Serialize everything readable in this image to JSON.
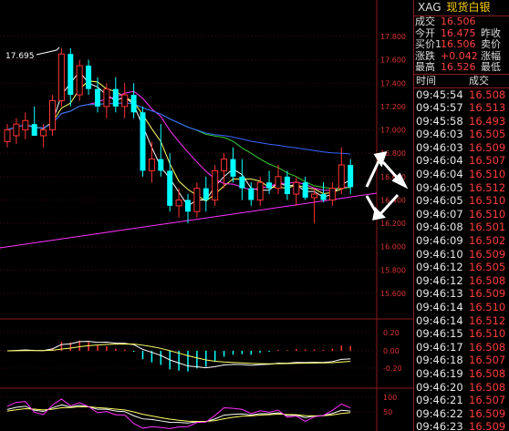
{
  "header": {
    "symbol": "XAG",
    "name": "现货白银"
  },
  "quote": [
    {
      "label": "成交",
      "value": "16.506",
      "label2": ""
    },
    {
      "label": "今开",
      "value": "16.475",
      "label2": "昨收"
    },
    {
      "label": "买价1",
      "value": "16.506",
      "label2": "卖价"
    },
    {
      "label": "涨跌",
      "value": "+0.042",
      "label2": "涨幅"
    },
    {
      "label": "最高",
      "value": "16.526",
      "label2": "最低"
    }
  ],
  "ticks_header": {
    "time": "时间",
    "price": "成交"
  },
  "ticks": [
    {
      "time": "09:45:54",
      "price": "16.508"
    },
    {
      "time": "09:45:57",
      "price": "16.513"
    },
    {
      "time": "09:45:58",
      "price": "16.493"
    },
    {
      "time": "09:46:03",
      "price": "16.505"
    },
    {
      "time": "09:46:03",
      "price": "16.509"
    },
    {
      "time": "09:46:04",
      "price": "16.507"
    },
    {
      "time": "09:46:04",
      "price": "16.510"
    },
    {
      "time": "09:46:05",
      "price": "16.512"
    },
    {
      "time": "09:46:05",
      "price": "16.510"
    },
    {
      "time": "09:46:07",
      "price": "16.510"
    },
    {
      "time": "09:46:08",
      "price": "16.501"
    },
    {
      "time": "09:46:09",
      "price": "16.502"
    },
    {
      "time": "09:46:10",
      "price": "16.509"
    },
    {
      "time": "09:46:12",
      "price": "16.505"
    },
    {
      "time": "09:46:12",
      "price": "16.508"
    },
    {
      "time": "09:46:13",
      "price": "16.509"
    },
    {
      "time": "09:46:14",
      "price": "16.510"
    },
    {
      "time": "09:46:14",
      "price": "16.512"
    },
    {
      "time": "09:46:15",
      "price": "16.510"
    },
    {
      "time": "09:46:17",
      "price": "16.508"
    },
    {
      "time": "09:46:18",
      "price": "16.507"
    },
    {
      "time": "09:46:19",
      "price": "16.508"
    },
    {
      "time": "09:46:20",
      "price": "16.508"
    },
    {
      "time": "09:46:21",
      "price": "16.507"
    },
    {
      "time": "09:46:22",
      "price": "16.509"
    },
    {
      "time": "09:46:23",
      "price": "16.509"
    }
  ],
  "main_chart": {
    "annotation": "17.695",
    "y_ticks": [
      "17.800",
      "17.600",
      "17.400",
      "17.200",
      "17.000",
      "16.800",
      "16.600",
      "16.400",
      "16.200",
      "16.000",
      "15.800",
      "15.600"
    ],
    "candles": [
      {
        "o": 16.9,
        "h": 17.05,
        "l": 16.85,
        "c": 17.0
      },
      {
        "o": 16.95,
        "h": 17.1,
        "l": 16.88,
        "c": 17.05
      },
      {
        "o": 17.0,
        "h": 17.15,
        "l": 16.92,
        "c": 17.08
      },
      {
        "o": 17.05,
        "h": 17.2,
        "l": 16.98,
        "c": 16.95
      },
      {
        "o": 16.95,
        "h": 17.05,
        "l": 16.85,
        "c": 17.0
      },
      {
        "o": 17.0,
        "h": 17.3,
        "l": 16.95,
        "c": 17.25
      },
      {
        "o": 17.25,
        "h": 17.7,
        "l": 17.2,
        "c": 17.65
      },
      {
        "o": 17.65,
        "h": 17.7,
        "l": 17.2,
        "c": 17.3
      },
      {
        "o": 17.3,
        "h": 17.6,
        "l": 17.25,
        "c": 17.55
      },
      {
        "o": 17.55,
        "h": 17.6,
        "l": 17.3,
        "c": 17.35
      },
      {
        "o": 17.35,
        "h": 17.45,
        "l": 17.15,
        "c": 17.2
      },
      {
        "o": 17.2,
        "h": 17.4,
        "l": 17.1,
        "c": 17.35
      },
      {
        "o": 17.35,
        "h": 17.45,
        "l": 17.15,
        "c": 17.2
      },
      {
        "o": 17.2,
        "h": 17.4,
        "l": 17.1,
        "c": 17.3
      },
      {
        "o": 17.3,
        "h": 17.4,
        "l": 17.1,
        "c": 17.15
      },
      {
        "o": 17.15,
        "h": 17.2,
        "l": 16.6,
        "c": 16.65
      },
      {
        "o": 16.65,
        "h": 16.9,
        "l": 16.55,
        "c": 16.75
      },
      {
        "o": 16.75,
        "h": 17.05,
        "l": 16.6,
        "c": 16.65
      },
      {
        "o": 16.65,
        "h": 16.8,
        "l": 16.3,
        "c": 16.35
      },
      {
        "o": 16.35,
        "h": 16.5,
        "l": 16.25,
        "c": 16.4
      },
      {
        "o": 16.4,
        "h": 16.45,
        "l": 16.2,
        "c": 16.3
      },
      {
        "o": 16.3,
        "h": 16.55,
        "l": 16.25,
        "c": 16.5
      },
      {
        "o": 16.5,
        "h": 16.6,
        "l": 16.3,
        "c": 16.4
      },
      {
        "o": 16.4,
        "h": 16.7,
        "l": 16.35,
        "c": 16.65
      },
      {
        "o": 16.65,
        "h": 16.8,
        "l": 16.5,
        "c": 16.75
      },
      {
        "o": 16.75,
        "h": 16.85,
        "l": 16.55,
        "c": 16.6
      },
      {
        "o": 16.6,
        "h": 16.75,
        "l": 16.4,
        "c": 16.5
      },
      {
        "o": 16.5,
        "h": 16.55,
        "l": 16.35,
        "c": 16.4
      },
      {
        "o": 16.4,
        "h": 16.6,
        "l": 16.35,
        "c": 16.55
      },
      {
        "o": 16.55,
        "h": 16.65,
        "l": 16.45,
        "c": 16.5
      },
      {
        "o": 16.5,
        "h": 16.7,
        "l": 16.45,
        "c": 16.6
      },
      {
        "o": 16.6,
        "h": 16.65,
        "l": 16.4,
        "c": 16.45
      },
      {
        "o": 16.45,
        "h": 16.6,
        "l": 16.35,
        "c": 16.55
      },
      {
        "o": 16.55,
        "h": 16.6,
        "l": 16.4,
        "c": 16.42
      },
      {
        "o": 16.42,
        "h": 16.5,
        "l": 16.2,
        "c": 16.45
      },
      {
        "o": 16.45,
        "h": 16.55,
        "l": 16.38,
        "c": 16.4
      },
      {
        "o": 16.4,
        "h": 16.55,
        "l": 16.35,
        "c": 16.5
      },
      {
        "o": 16.5,
        "h": 16.85,
        "l": 16.45,
        "c": 16.7
      },
      {
        "o": 16.7,
        "h": 16.75,
        "l": 16.45,
        "c": 16.51
      }
    ]
  },
  "macd_panel": {
    "y_ticks": [
      "0.20",
      "0.00",
      "-0.20"
    ]
  },
  "kdj_panel": {
    "y_ticks": [
      "100",
      "50"
    ]
  },
  "colors": {
    "up": "#ff3333",
    "down": "#00ffff",
    "ma_yellow": "#ffff66",
    "ma_white": "#ffffff",
    "ma_magenta": "#ff33ff",
    "ma_green": "#33cc33",
    "ma_blue": "#3366ff"
  }
}
